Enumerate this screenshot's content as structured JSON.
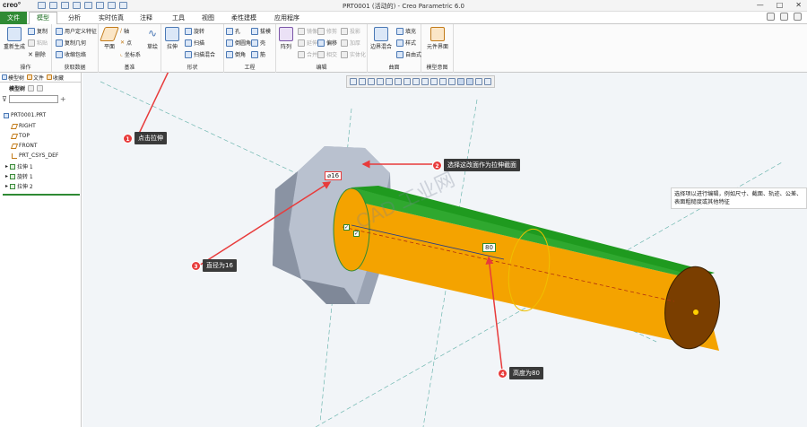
{
  "app": {
    "logo": "creo°",
    "window_title": "PRT0001 (活动的) - Creo Parametric 6.0",
    "win_controls": [
      "—",
      "□",
      "✕"
    ]
  },
  "tabs": [
    "文件",
    "模型",
    "分析",
    "实时仿真",
    "注释",
    "工具",
    "视图",
    "柔性建模",
    "应用程序"
  ],
  "ribbon": {
    "ops": {
      "regen": "重新生成",
      "copy": "复制",
      "paste": "粘贴",
      "delete": "删除",
      "label": "操作"
    },
    "data": {
      "udf": "用户定义特征",
      "copy_geom": "复制几何",
      "shrinkwrap": "收缩包络",
      "label": "获取数据"
    },
    "datum": {
      "plane": "平面",
      "axis": "轴",
      "point": "点",
      "csys": "坐标系",
      "sketch": "草绘",
      "label": "基准"
    },
    "shapes": {
      "extrude": "拉伸",
      "revolve": "旋转",
      "sweep": "扫描",
      "swept_blend": "扫描混合",
      "label": "形状"
    },
    "engineering": {
      "hole": "孔",
      "round": "倒圆角",
      "chamfer": "倒角",
      "draft": "拔模",
      "shell": "壳",
      "rib": "筋",
      "label": "工程"
    },
    "editing": {
      "pattern": "阵列",
      "mirror": "镜像",
      "extend": "延伸",
      "project": "投影",
      "trim": "修剪",
      "offset": "偏移",
      "thicken": "加厚",
      "merge": "合并",
      "intersect": "相交",
      "solidify": "实体化",
      "label": "编辑"
    },
    "surfaces": {
      "boundary": "边界混合",
      "fill": "填充",
      "style": "样式",
      "freestyle": "自由式",
      "label": "曲面"
    },
    "intent": {
      "component": "元件界面",
      "label": "模型意图"
    }
  },
  "left_panel": {
    "tabs": [
      "模型树",
      "文件",
      "收藏"
    ],
    "header": "模型树",
    "tree": [
      {
        "label": "PRT0001.PRT",
        "kind": "part"
      },
      {
        "label": "RIGHT",
        "kind": "plane"
      },
      {
        "label": "TOP",
        "kind": "plane"
      },
      {
        "label": "FRONT",
        "kind": "plane"
      },
      {
        "label": "PRT_CSYS_DEF",
        "kind": "csys"
      },
      {
        "label": "拉伸 1",
        "kind": "feat"
      },
      {
        "label": "旋转 1",
        "kind": "feat"
      },
      {
        "label": "拉伸 2",
        "kind": "feat"
      }
    ]
  },
  "graphics": {
    "hint": "选择项以进行编辑，例如尺寸、截面、轨迹、公差、表面粗糙度或其他特征",
    "dim_diameter": "⌀16",
    "dim_height": "80",
    "watermark": "CAD 工业网"
  },
  "callouts": [
    {
      "num": "1",
      "text": "点击拉伸"
    },
    {
      "num": "2",
      "text": "选择这改面作为拉伸截面"
    },
    {
      "num": "3",
      "text": "直径为16"
    },
    {
      "num": "4",
      "text": "高度为80"
    }
  ],
  "colors": {
    "accent": "#2f8a34",
    "cyl_top": "#1f9a1f",
    "cyl_side": "#f4a300",
    "cyl_end": "#7a3e00",
    "hex_face": "#a9b2c4",
    "callout_red": "#e83b3b"
  }
}
